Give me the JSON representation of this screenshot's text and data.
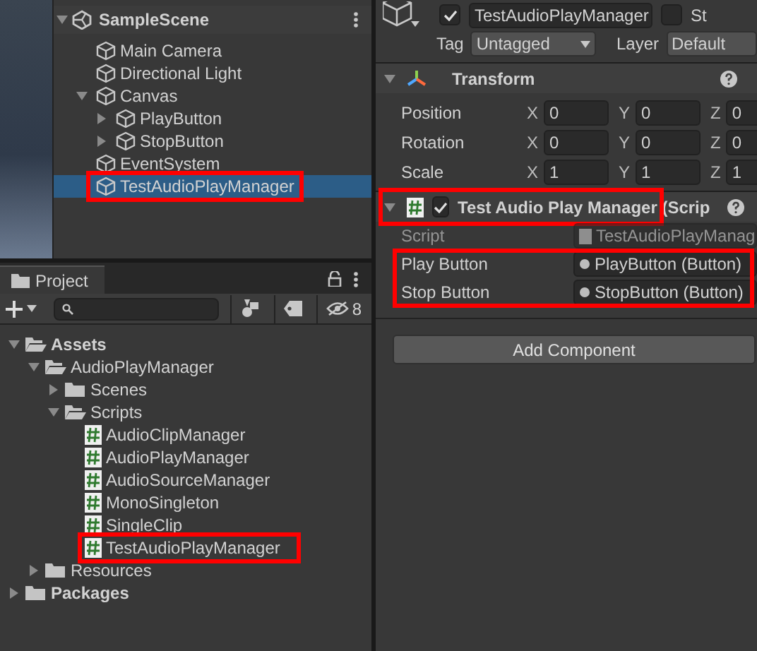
{
  "hierarchy": {
    "scene": {
      "name": "SampleScene",
      "expanded": true
    },
    "items": [
      {
        "name": "Main Camera",
        "selected": false
      },
      {
        "name": "Directional Light",
        "selected": false
      },
      {
        "name": "Canvas",
        "selected": false,
        "expanded": true,
        "children": [
          {
            "name": "PlayButton",
            "selected": false,
            "expanded": false
          },
          {
            "name": "StopButton",
            "selected": false,
            "expanded": false
          }
        ]
      },
      {
        "name": "EventSystem",
        "selected": false
      },
      {
        "name": "TestAudioPlayManager",
        "selected": true,
        "highlighted": true
      }
    ]
  },
  "project": {
    "tab": "Project",
    "hidden_count": "8",
    "tree": [
      {
        "name": "Assets",
        "kind": "root",
        "expanded": true,
        "children": [
          {
            "name": "AudioPlayManager",
            "kind": "folder",
            "expanded": true,
            "children": [
              {
                "name": "Scenes",
                "kind": "folder",
                "expanded": false
              },
              {
                "name": "Scripts",
                "kind": "folder",
                "expanded": true,
                "children": [
                  {
                    "name": "AudioClipManager",
                    "kind": "script"
                  },
                  {
                    "name": "AudioPlayManager",
                    "kind": "script"
                  },
                  {
                    "name": "AudioSourceManager",
                    "kind": "script"
                  },
                  {
                    "name": "MonoSingleton",
                    "kind": "script"
                  },
                  {
                    "name": "SingleClip",
                    "kind": "script"
                  },
                  {
                    "name": "TestAudioPlayManager",
                    "kind": "script",
                    "highlighted": true
                  }
                ]
              }
            ]
          },
          {
            "name": "Resources",
            "kind": "folder",
            "expanded": false
          }
        ]
      },
      {
        "name": "Packages",
        "kind": "root",
        "expanded": false
      }
    ]
  },
  "inspector": {
    "object_name": "TestAudioPlayManager",
    "active": true,
    "static": false,
    "static_label": "St",
    "tag_label": "Tag",
    "tag": "Untagged",
    "layer_label": "Layer",
    "layer": "Default",
    "transform": {
      "title": "Transform",
      "expanded": true,
      "rows": [
        {
          "label": "Position",
          "axes": [
            {
              "label": "X",
              "value": "0"
            },
            {
              "label": "Y",
              "value": "0"
            },
            {
              "label": "Z",
              "value": "0"
            }
          ]
        },
        {
          "label": "Rotation",
          "axes": [
            {
              "label": "X",
              "value": "0"
            },
            {
              "label": "Y",
              "value": "0"
            },
            {
              "label": "Z",
              "value": "0"
            }
          ]
        },
        {
          "label": "Scale",
          "axes": [
            {
              "label": "X",
              "value": "1"
            },
            {
              "label": "Y",
              "value": "1"
            },
            {
              "label": "Z",
              "value": "1"
            }
          ]
        }
      ]
    },
    "component": {
      "title": "Test Audio Play Manager (Scrip",
      "enabled": true,
      "expanded": true,
      "highlighted": true,
      "script": {
        "label": "Script",
        "value": "TestAudioPlayManag",
        "disabled": true
      },
      "fields_highlighted": true,
      "fields": [
        {
          "label": "Play Button",
          "value": "PlayButton (Button)"
        },
        {
          "label": "Stop Button",
          "value": "StopButton (Button)"
        }
      ]
    },
    "add_button": "Add Component"
  }
}
